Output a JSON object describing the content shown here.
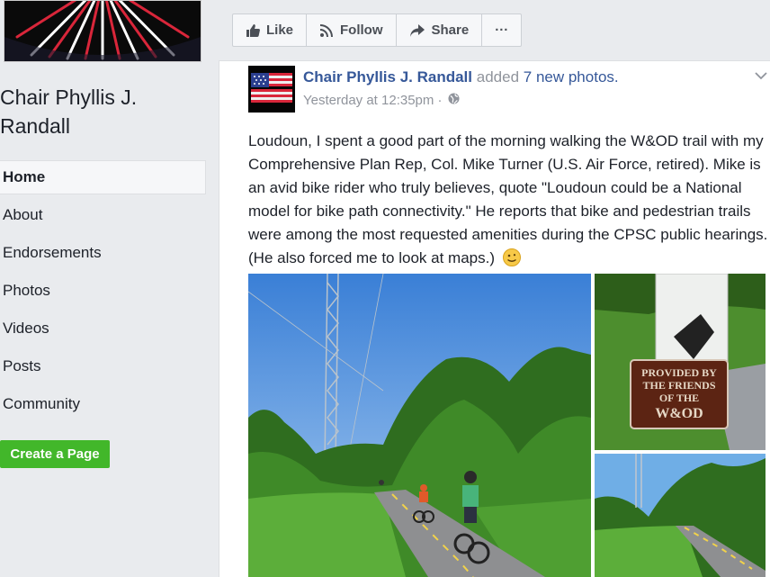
{
  "sidebar": {
    "page_name": "Chair Phyllis J. Randall",
    "nav": [
      {
        "label": "Home",
        "active": true
      },
      {
        "label": "About"
      },
      {
        "label": "Endorsements"
      },
      {
        "label": "Photos"
      },
      {
        "label": "Videos"
      },
      {
        "label": "Posts"
      },
      {
        "label": "Community"
      }
    ],
    "create_page_label": "Create a Page"
  },
  "actions": {
    "like_label": "Like",
    "follow_label": "Follow",
    "share_label": "Share",
    "more_label": "···"
  },
  "post": {
    "author": "Chair Phyllis J. Randall",
    "added_text": "added",
    "photos_link": "7 new photos.",
    "timestamp": "Yesterday at 12:35pm · ",
    "text": "Loudoun, I spent a good part of the morning walking the W&OD trail with my Comprehensive Plan Rep, Col. Mike Turner (U.S. Air Force, retired). Mike is an avid bike rider who truly believes, quote \"Loudoun could be a National model for bike path connectivity.\" He reports that bike and pedestrian trails were among the most requested amenities during the CPSC public hearings. (He also forced me to look at maps.)",
    "sign_text": [
      "PROVIDED BY",
      "THE FRIENDS",
      "OF THE",
      "W&OD"
    ]
  },
  "icons": {
    "like": "thumbs-up-icon",
    "follow": "rss-icon",
    "share": "share-arrow-icon",
    "privacy": "globe-icon",
    "emoji": "smile-icon"
  },
  "colors": {
    "link": "#365899",
    "green_button": "#42b72a",
    "background": "#e9ebee"
  }
}
